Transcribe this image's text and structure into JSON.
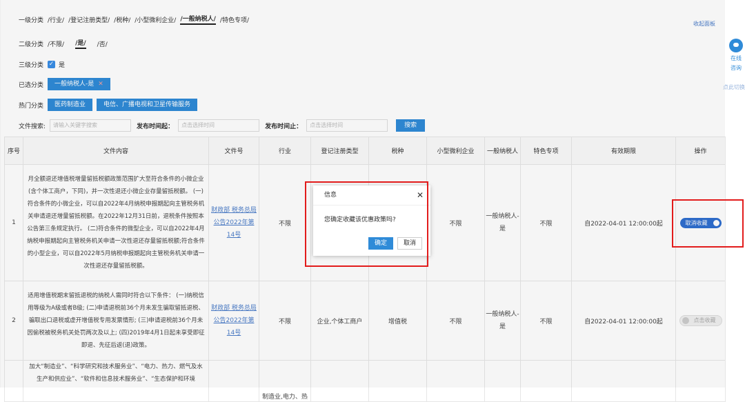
{
  "filters": {
    "level1": {
      "label": "一级分类",
      "options": [
        "/行业/",
        "/登记注册类型/",
        "/税种/",
        "/小型微利企业/",
        "/一般纳税人/",
        "/特色专项/"
      ],
      "selected_index": 4
    },
    "level2": {
      "label": "二级分类",
      "options": [
        "/不限/",
        "/是/",
        "/否/"
      ],
      "selected_index": 1
    },
    "level3": {
      "label": "三级分类",
      "check_label": "是"
    },
    "selected": {
      "label": "已选分类",
      "tag": "一般纳税人-是"
    },
    "hot": {
      "label": "热门分类",
      "tags": [
        "医药制造业",
        "电信、广播电视和卫星传输服务"
      ]
    },
    "collapse_link": "收起面板"
  },
  "search": {
    "file_label": "文件搜索:",
    "file_placeholder": "请输入关键字搜索",
    "from_label": "发布时间起：",
    "from_placeholder": "点击选择时间",
    "to_label": "发布时间止：",
    "to_placeholder": "点击选择时间",
    "button": "搜索"
  },
  "table": {
    "headers": [
      "序号",
      "文件内容",
      "文件号",
      "行业",
      "登记注册类型",
      "税种",
      "小型微利企业",
      "一般纳税人",
      "特色专项",
      "有效期限",
      "操作"
    ],
    "rows": [
      {
        "index": "1",
        "content": "月全额退还增值税增量留抵税额政策范围扩大至符合条件的小微企业(含个体工商户，下同)，并一次性退还小微企业存量留抵税额。 (一)符合条件的小微企业，可以自2022年4月纳税申报期起向主管税务机关申请退还增量留抵税额。在2022年12月31日前，退税条件按照本公告第三条规定执行。 (二)符合条件的微型企业，可以自2022年4月纳税申报期起向主管税务机关申请一次性退还存量留抵税额;符合条件的小型企业，可以自2022年5月纳税申报期起向主管税务机关申请一次性退还存量留抵税额。",
        "doc_no": "财政部 税务总局公告2022年第14号",
        "industry": "不限",
        "reg_type": "",
        "tax_type": "",
        "small_micro": "不限",
        "general_taxpayer": "一般纳税人-是",
        "special": "不限",
        "valid": "自2022-04-01 12:00:00起",
        "action": "取消收藏"
      },
      {
        "index": "2",
        "content": "适用增值税期末留抵退税的纳税人需同时符合以下条件： (一)纳税信用等级为A级或者B级; (二)申请退税前36个月未发生骗取留抵退税、骗取出口退税或虚开增值税专用发票情形; (三)申请退税前36个月未因偷税被税务机关处罚两次及以上; (四)2019年4月1日起未享受即征即退、先征后返(退)政策。",
        "doc_no": "财政部 税务总局公告2022年第14号",
        "industry": "不限",
        "reg_type": "企业,个体工商户",
        "tax_type": "增值税",
        "small_micro": "不限",
        "general_taxpayer": "一般纳税人-是",
        "special": "不限",
        "valid": "自2022-04-01 12:00:00起",
        "action": "点击收藏"
      },
      {
        "index": "",
        "content": "加大“制造业”、“科学研究和技术服务业”、“电力、热力、燃气及水生产和供应业”、“软件和信息技术服务业”、“生态保护和环境",
        "doc_no": "",
        "industry": "制造业,电力、热",
        "reg_type": "",
        "tax_type": "",
        "small_micro": "",
        "general_taxpayer": "",
        "special": "",
        "valid": "",
        "action": ""
      }
    ]
  },
  "dialog": {
    "title": "信息",
    "close": "✕",
    "message": "您确定收藏该优惠政策吗?",
    "ok": "确定",
    "cancel": "取消"
  },
  "side": {
    "line1": "在线",
    "line2": "咨询",
    "faint": "点此切换"
  },
  "colors": {
    "primary": "#2f8bd8",
    "highlight": "#e21b1b",
    "link": "#4a7cc9"
  }
}
